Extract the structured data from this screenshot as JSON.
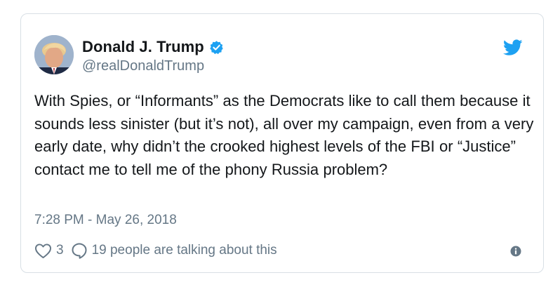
{
  "author": {
    "display_name": "Donald J. Trump",
    "handle": "@realDonaldTrump",
    "verified": true,
    "verified_icon": "verified-badge-icon",
    "avatar": "profile-photo"
  },
  "tweet": {
    "text": "With Spies, or “Informants” as the Democrats like to call them because it sounds less sinister (but it’s not), all over my campaign, even from a very early date, why didn’t the crooked highest levels of the FBI or “Justice” contact me to tell me of the phony Russia problem?",
    "timestamp": "7:28 PM - May 26, 2018"
  },
  "engagement": {
    "like_icon": "heart-icon",
    "like_count": "3",
    "reply_icon": "speech-bubble-icon",
    "talking_text": "19 people are talking about this",
    "info_icon": "info-icon"
  },
  "brand": {
    "logo_icon": "twitter-bird-icon",
    "accent_color": "#1da1f2",
    "text_color": "#14171a",
    "muted_color": "#657786"
  }
}
